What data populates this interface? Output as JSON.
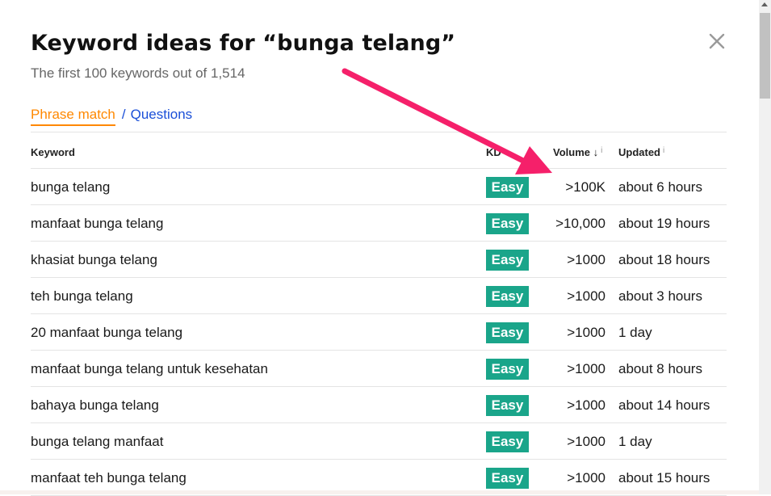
{
  "modal": {
    "title": "Keyword ideas for “bunga telang”",
    "subtitle": "The first 100 keywords out of 1,514",
    "close_icon": "close-icon"
  },
  "tabs": {
    "phrase_match": "Phrase match",
    "separator": "/",
    "questions": "Questions"
  },
  "table": {
    "headers": {
      "keyword": "Keyword",
      "kd": "KD",
      "volume": "Volume",
      "volume_sort": "↓",
      "volume_info": "i",
      "updated": "Updated",
      "updated_info": "i"
    },
    "rows": [
      {
        "keyword": "bunga telang",
        "kd": "Easy",
        "volume": ">100K",
        "updated": "about 6 hours"
      },
      {
        "keyword": "manfaat bunga telang",
        "kd": "Easy",
        "volume": ">10,000",
        "updated": "about 19 hours"
      },
      {
        "keyword": "khasiat bunga telang",
        "kd": "Easy",
        "volume": ">1000",
        "updated": "about 18 hours"
      },
      {
        "keyword": "teh bunga telang",
        "kd": "Easy",
        "volume": ">1000",
        "updated": "about 3 hours"
      },
      {
        "keyword": "20 manfaat bunga telang",
        "kd": "Easy",
        "volume": ">1000",
        "updated": "1 day"
      },
      {
        "keyword": "manfaat bunga telang untuk kesehatan",
        "kd": "Easy",
        "volume": ">1000",
        "updated": "about 8 hours"
      },
      {
        "keyword": "bahaya bunga telang",
        "kd": "Easy",
        "volume": ">1000",
        "updated": "about 14 hours"
      },
      {
        "keyword": "bunga telang manfaat",
        "kd": "Easy",
        "volume": ">1000",
        "updated": "1 day"
      },
      {
        "keyword": "manfaat teh bunga telang",
        "kd": "Easy",
        "volume": ">1000",
        "updated": "about 15 hours"
      }
    ]
  },
  "colors": {
    "accent_orange": "#ff8800",
    "link_blue": "#1a4fd8",
    "easy_badge": "#1aa58a",
    "annotation_arrow": "#f5206a"
  }
}
